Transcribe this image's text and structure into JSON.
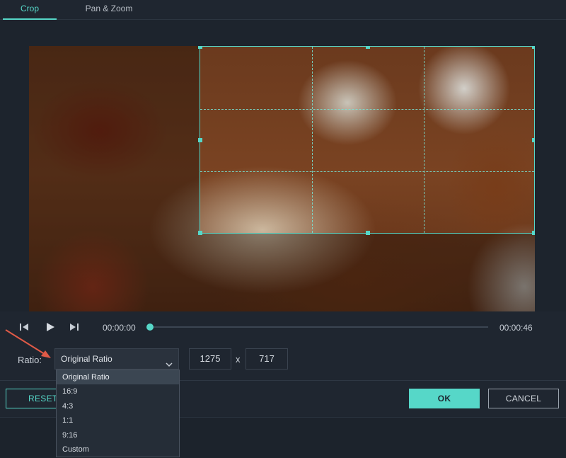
{
  "tabs": [
    {
      "label": "Crop",
      "active": true
    },
    {
      "label": "Pan & Zoom",
      "active": false
    }
  ],
  "player": {
    "current_time": "00:00:00",
    "total_time": "00:00:46",
    "progress": 0.0
  },
  "ratio": {
    "label": "Ratio:",
    "selected": "Original Ratio",
    "width": "1275",
    "times": "x",
    "height": "717",
    "options": [
      "Original Ratio",
      "16:9",
      "4:3",
      "1:1",
      "9:16",
      "Custom"
    ]
  },
  "buttons": {
    "reset": "RESET",
    "ok": "OK",
    "cancel": "CANCEL"
  },
  "colors": {
    "accent": "#56d7c8",
    "background": "#1f2630",
    "annotation_arrow": "#e05a47"
  },
  "icons": {
    "prev_frame": "step-back-icon",
    "play": "play-icon",
    "next_frame": "step-forward-icon",
    "dropdown": "chevron-down-icon"
  }
}
